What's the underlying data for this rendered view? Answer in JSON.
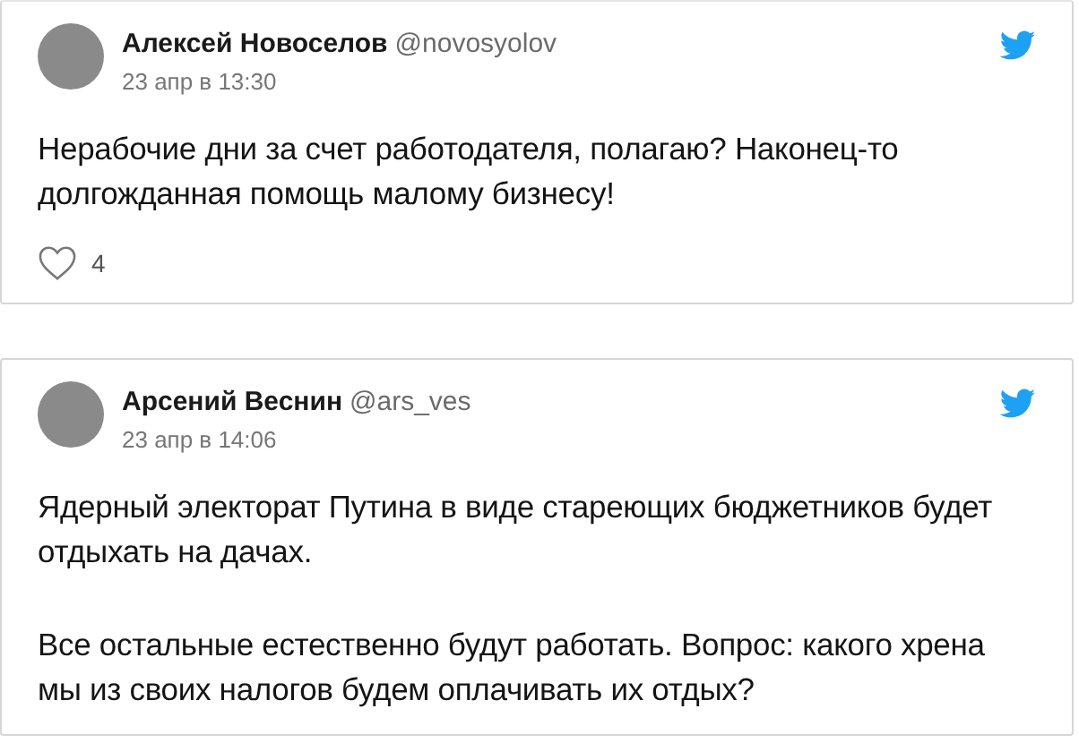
{
  "tweets": [
    {
      "author": "Алексей Новоселов",
      "handle": "@novosyolov",
      "date": "23 апр в 13:30",
      "paragraphs": [
        "Нерабочие дни за счет работодателя, полагаю? Наконец-то долгожданная помощь малому бизнесу!"
      ],
      "likes": "4"
    },
    {
      "author": "Арсений Веснин",
      "handle": "@ars_ves",
      "date": "23 апр в 14:06",
      "paragraphs": [
        "Ядерный электорат Путина в виде стареющих бюджетников будет отдыхать на дачах.",
        "Все остальные естественно будут работать. Вопрос: какого хрена мы из своих налогов будем оплачивать их отдых?"
      ]
    }
  ]
}
